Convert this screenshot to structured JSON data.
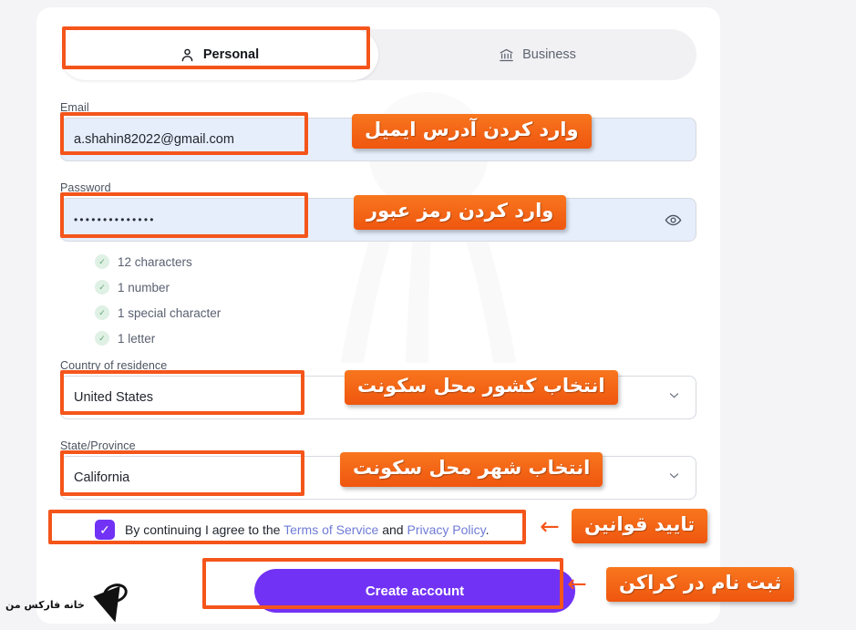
{
  "page": {
    "background_color": "#f4f4f7",
    "card_background": "#ffffff"
  },
  "tabs": [
    {
      "id": "personal",
      "label": "Personal",
      "icon": "person-icon",
      "active": true
    },
    {
      "id": "business",
      "label": "Business",
      "icon": "bank-icon",
      "active": false
    }
  ],
  "form": {
    "email": {
      "label": "Email",
      "value": "a.shahin82022@gmail.com",
      "placeholder": "Email"
    },
    "password": {
      "label": "Password",
      "value": "••••••••••••••",
      "placeholder": "Password",
      "toggle_icon": "eye-icon"
    },
    "password_rules": [
      {
        "label": "12 characters",
        "met": true
      },
      {
        "label": "1 number",
        "met": true
      },
      {
        "label": "1 special character",
        "met": true
      },
      {
        "label": "1 letter",
        "met": true
      }
    ],
    "country": {
      "label": "Country of residence",
      "value": "United States"
    },
    "state": {
      "label": "State/Province",
      "value": "California"
    },
    "terms": {
      "checked": true,
      "text_before": "By continuing I agree to the ",
      "link_terms": "Terms of Service",
      "text_middle": " and ",
      "link_privacy": "Privacy Policy",
      "text_after": "."
    },
    "submit": {
      "label": "Create account",
      "color": "#7132f5"
    }
  },
  "annotations": {
    "highlight_color": "#f4551b",
    "callouts": [
      {
        "id": "email-callout",
        "text": "وارد کردن آدرس ایمیل"
      },
      {
        "id": "password-callout",
        "text": "وارد کردن رمز عبور"
      },
      {
        "id": "country-callout",
        "text": "انتخاب کشور محل سکونت"
      },
      {
        "id": "state-callout",
        "text": "انتخاب شهر محل سکونت"
      },
      {
        "id": "terms-callout",
        "text": "تایید قوانین"
      },
      {
        "id": "submit-callout",
        "text": "ثبت نام در کراکن"
      }
    ],
    "arrow_glyph": "←"
  },
  "watermark": {
    "text": "خانه فارکس من"
  }
}
